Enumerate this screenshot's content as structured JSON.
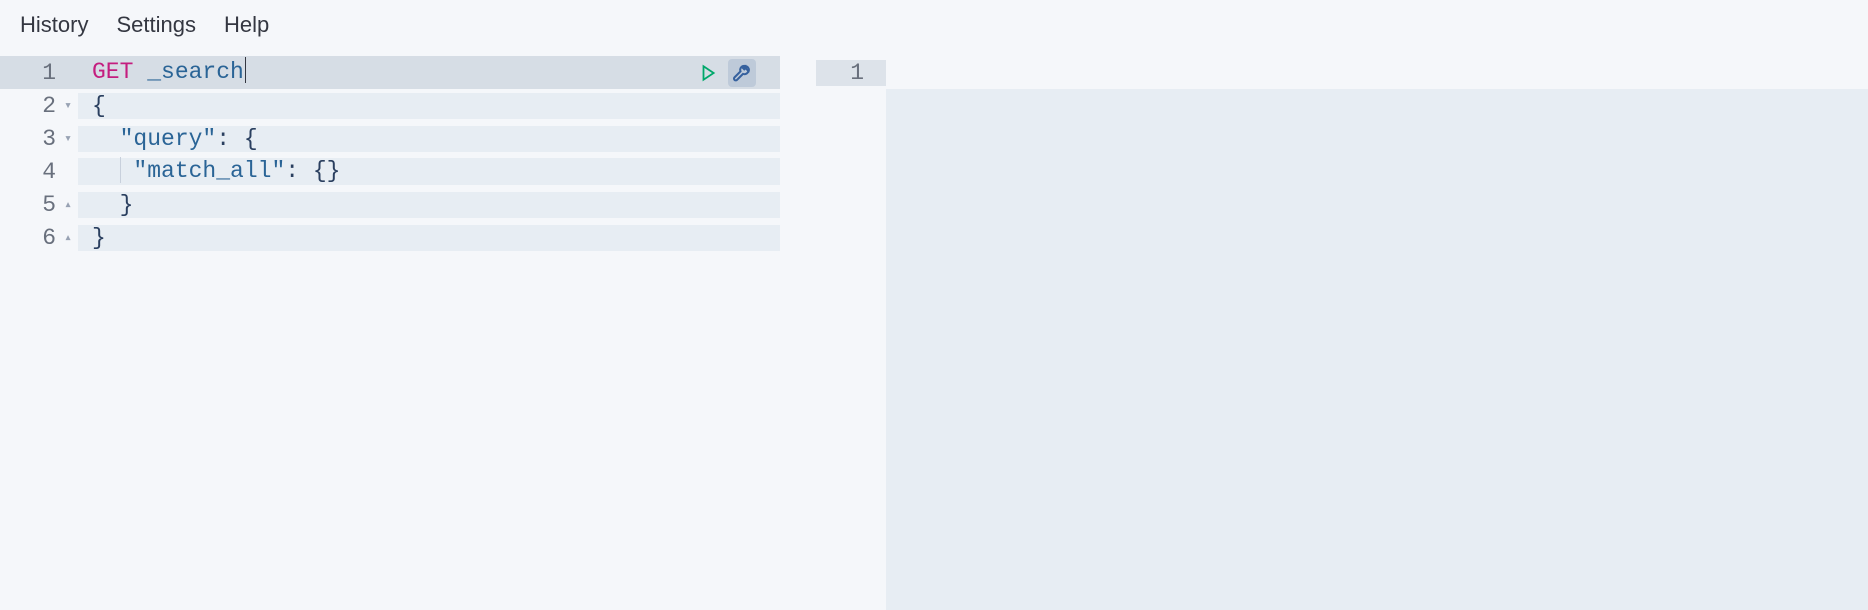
{
  "menu": {
    "history": "History",
    "settings": "Settings",
    "help": "Help"
  },
  "editor": {
    "lines": [
      {
        "n": "1",
        "fold": "",
        "method": "GET",
        "endpoint": " _search",
        "active": true,
        "cursor": true
      },
      {
        "n": "2",
        "fold": "▾",
        "text": "{"
      },
      {
        "n": "3",
        "fold": "▾",
        "indent": 1,
        "key": "\"query\"",
        "after": ": {"
      },
      {
        "n": "4",
        "fold": "",
        "indent": 2,
        "guide": true,
        "key": "\"match_all\"",
        "after": ": {}"
      },
      {
        "n": "5",
        "fold": "▴",
        "indent": 1,
        "text": "}"
      },
      {
        "n": "6",
        "fold": "▴",
        "text": "}"
      }
    ]
  },
  "output": {
    "lines": [
      {
        "n": "1",
        "text": "",
        "active": true
      }
    ]
  },
  "actions": {
    "run": "run-request",
    "wrench": "request-options"
  }
}
